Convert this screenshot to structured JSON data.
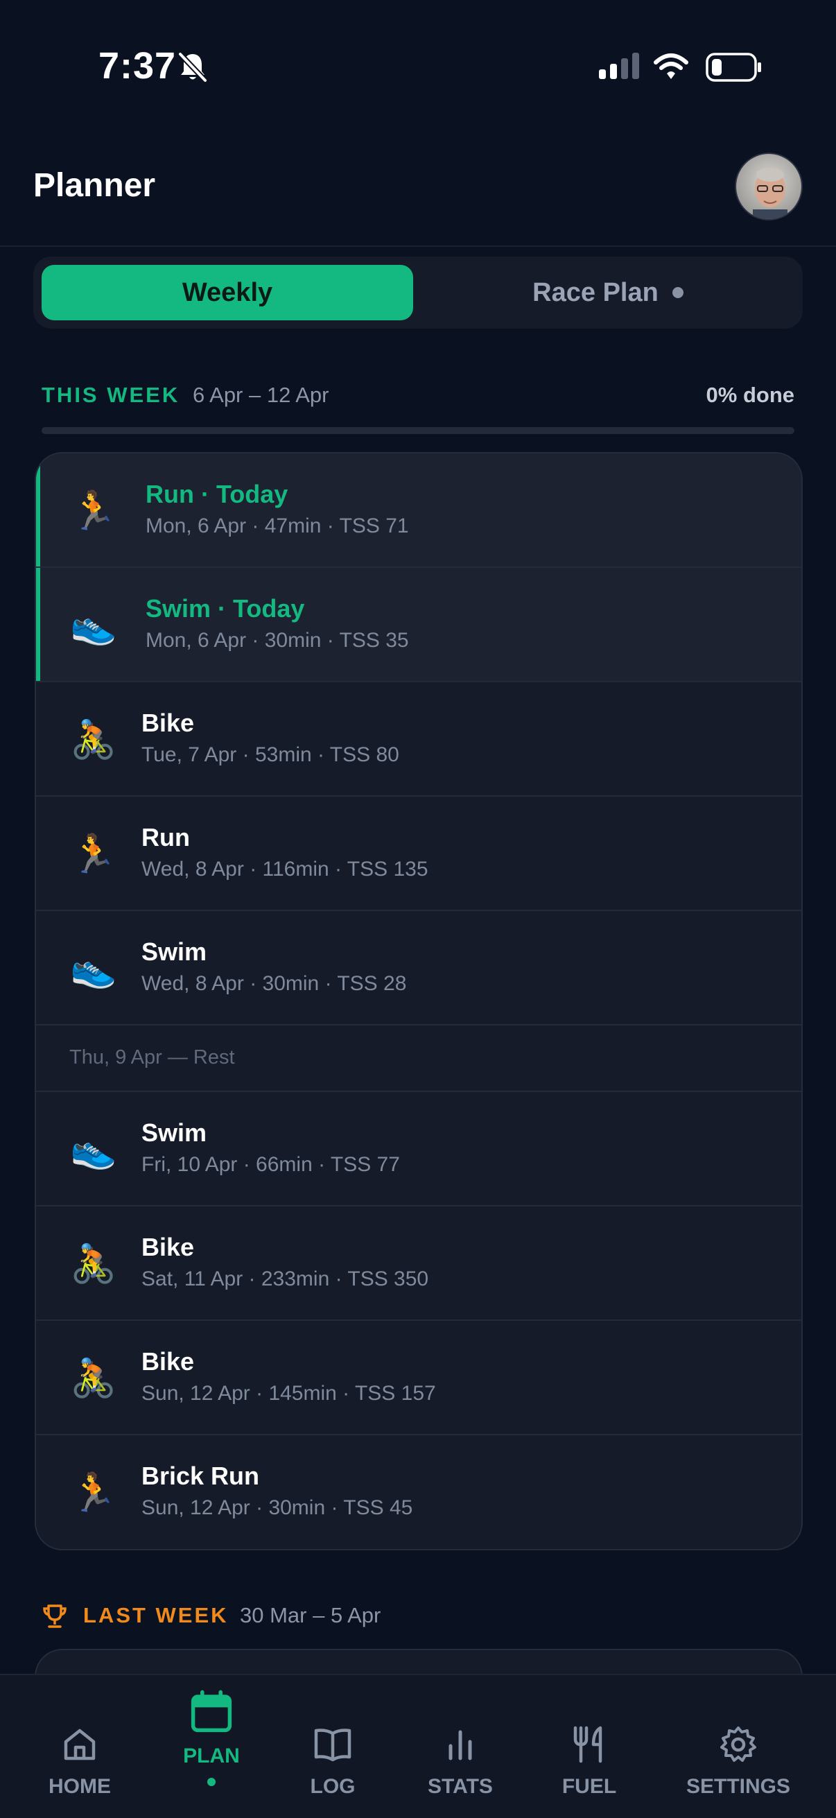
{
  "status_bar": {
    "time": "7:37"
  },
  "header": {
    "title": "Planner"
  },
  "segments": {
    "weekly": "Weekly",
    "race_plan": "Race Plan"
  },
  "this_week": {
    "label": "THIS WEEK",
    "range": "6 Apr – 12 Apr",
    "done": "0% done",
    "progress_fraction": 0
  },
  "sessions": [
    {
      "icon": "runner-icon",
      "title": "Run · Today",
      "sub": "Mon, 6 Apr · 47min · TSS 71",
      "today": true
    },
    {
      "icon": "shoe-icon",
      "title": "Swim · Today",
      "sub": "Mon, 6 Apr · 30min · TSS 35",
      "today": true
    },
    {
      "icon": "cyclist-icon",
      "title": "Bike",
      "sub": "Tue, 7 Apr · 53min · TSS 80"
    },
    {
      "icon": "runner-icon",
      "title": "Run",
      "sub": "Wed, 8 Apr · 116min · TSS 135"
    },
    {
      "icon": "shoe-icon",
      "title": "Swim",
      "sub": "Wed, 8 Apr · 30min · TSS 28"
    },
    {
      "rest": "Thu, 9 Apr — Rest"
    },
    {
      "icon": "shoe-icon",
      "title": "Swim",
      "sub": "Fri, 10 Apr · 66min · TSS 77"
    },
    {
      "icon": "cyclist-icon",
      "title": "Bike",
      "sub": "Sat, 11 Apr · 233min · TSS 350"
    },
    {
      "icon": "cyclist-icon",
      "title": "Bike",
      "sub": "Sun, 12 Apr · 145min · TSS 157"
    },
    {
      "icon": "runner-icon",
      "title": "Brick Run",
      "sub": "Sun, 12 Apr · 30min · TSS 45"
    }
  ],
  "last_week": {
    "label": "LAST WEEK",
    "range": "30 Mar – 5 Apr"
  },
  "nav": {
    "home": "HOME",
    "plan": "PLAN",
    "log": "LOG",
    "stats": "STATS",
    "fuel": "FUEL",
    "settings": "SETTINGS",
    "active": "plan"
  },
  "colors": {
    "accent": "#13b981",
    "last_week": "#f08a1c",
    "background": "#0a1120"
  }
}
